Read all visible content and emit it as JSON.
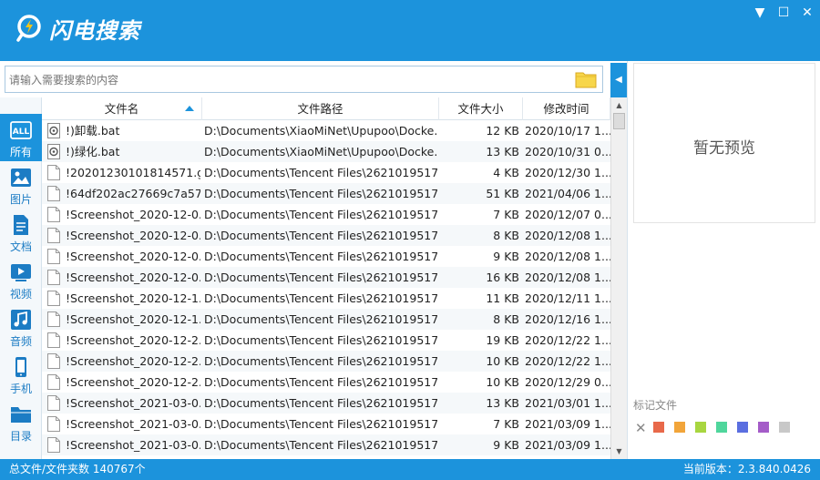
{
  "app": {
    "title": "闪电搜索"
  },
  "window": {
    "min": "▼",
    "max": "☐",
    "close": "✕"
  },
  "search": {
    "placeholder": "请输入需要搜索的内容"
  },
  "sidebar": {
    "items": [
      {
        "label": "所有",
        "icon": "all-icon"
      },
      {
        "label": "图片",
        "icon": "image-icon"
      },
      {
        "label": "文档",
        "icon": "document-icon"
      },
      {
        "label": "视频",
        "icon": "video-icon"
      },
      {
        "label": "音频",
        "icon": "audio-icon"
      },
      {
        "label": "手机",
        "icon": "phone-icon"
      },
      {
        "label": "目录",
        "icon": "folder-icon"
      }
    ]
  },
  "table": {
    "columns": [
      "文件名",
      "文件路径",
      "文件大小",
      "修改时间"
    ],
    "rows": [
      {
        "name": "!)卸载.bat",
        "path": "D:\\Documents\\XiaoMiNet\\Upupoo\\Docke...",
        "size": "12 KB",
        "time": "2020/10/17 1...",
        "type": "bat"
      },
      {
        "name": "!)绿化.bat",
        "path": "D:\\Documents\\XiaoMiNet\\Upupoo\\Docke...",
        "size": "13 KB",
        "time": "2020/10/31 0...",
        "type": "bat"
      },
      {
        "name": "!20201230101814571.gi...",
        "path": "D:\\Documents\\Tencent Files\\2621019517\\...",
        "size": "4 KB",
        "time": "2020/12/30 1...",
        "type": "file"
      },
      {
        "name": "!64df202ac27669c7a57...",
        "path": "D:\\Documents\\Tencent Files\\2621019517\\...",
        "size": "51 KB",
        "time": "2021/04/06 1...",
        "type": "file"
      },
      {
        "name": "!Screenshot_2020-12-0...",
        "path": "D:\\Documents\\Tencent Files\\2621019517\\...",
        "size": "7 KB",
        "time": "2020/12/07 0...",
        "type": "file"
      },
      {
        "name": "!Screenshot_2020-12-0...",
        "path": "D:\\Documents\\Tencent Files\\2621019517\\...",
        "size": "8 KB",
        "time": "2020/12/08 1...",
        "type": "file"
      },
      {
        "name": "!Screenshot_2020-12-0...",
        "path": "D:\\Documents\\Tencent Files\\2621019517\\...",
        "size": "9 KB",
        "time": "2020/12/08 1...",
        "type": "file"
      },
      {
        "name": "!Screenshot_2020-12-0...",
        "path": "D:\\Documents\\Tencent Files\\2621019517\\...",
        "size": "16 KB",
        "time": "2020/12/08 1...",
        "type": "file"
      },
      {
        "name": "!Screenshot_2020-12-1...",
        "path": "D:\\Documents\\Tencent Files\\2621019517\\...",
        "size": "11 KB",
        "time": "2020/12/11 1...",
        "type": "file"
      },
      {
        "name": "!Screenshot_2020-12-1...",
        "path": "D:\\Documents\\Tencent Files\\2621019517\\...",
        "size": "8 KB",
        "time": "2020/12/16 1...",
        "type": "file"
      },
      {
        "name": "!Screenshot_2020-12-2...",
        "path": "D:\\Documents\\Tencent Files\\2621019517\\...",
        "size": "19 KB",
        "time": "2020/12/22 1...",
        "type": "file"
      },
      {
        "name": "!Screenshot_2020-12-2...",
        "path": "D:\\Documents\\Tencent Files\\2621019517\\...",
        "size": "10 KB",
        "time": "2020/12/22 1...",
        "type": "file"
      },
      {
        "name": "!Screenshot_2020-12-2...",
        "path": "D:\\Documents\\Tencent Files\\2621019517\\...",
        "size": "10 KB",
        "time": "2020/12/29 0...",
        "type": "file"
      },
      {
        "name": "!Screenshot_2021-03-0...",
        "path": "D:\\Documents\\Tencent Files\\2621019517\\...",
        "size": "13 KB",
        "time": "2021/03/01 1...",
        "type": "file"
      },
      {
        "name": "!Screenshot_2021-03-0...",
        "path": "D:\\Documents\\Tencent Files\\2621019517\\...",
        "size": "7 KB",
        "time": "2021/03/09 1...",
        "type": "file"
      },
      {
        "name": "!Screenshot_2021-03-0...",
        "path": "D:\\Documents\\Tencent Files\\2621019517\\...",
        "size": "9 KB",
        "time": "2021/03/09 1...",
        "type": "file"
      }
    ]
  },
  "preview": {
    "empty_text": "暂无预览"
  },
  "marks": {
    "title": "标记文件",
    "colors": [
      "#e8694a",
      "#f2a53a",
      "#a8d640",
      "#4fd69c",
      "#5a6ee0",
      "#a45cc8",
      "#c8c8c8"
    ]
  },
  "status": {
    "left": "总文件/文件夹数 140767个",
    "right": "当前版本：2.3.840.0426"
  },
  "colors": {
    "accent": "#1c93dc"
  }
}
